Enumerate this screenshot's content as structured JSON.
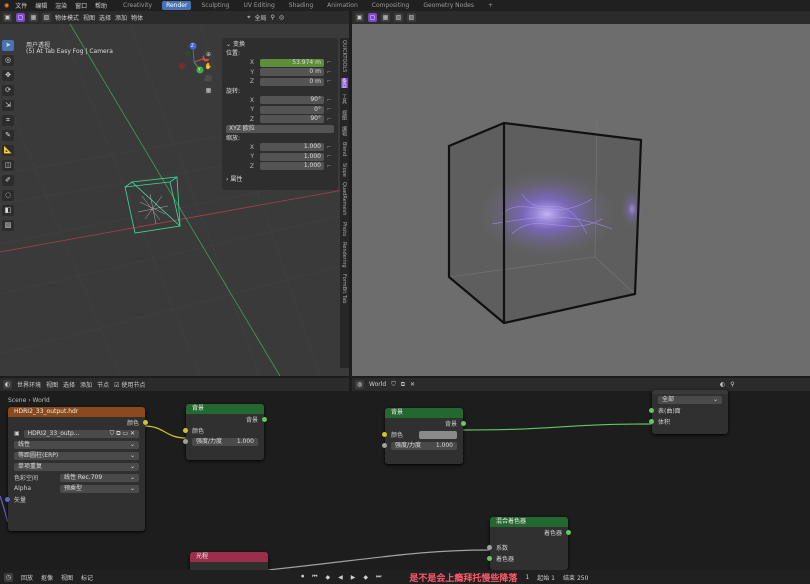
{
  "topbar": {
    "menus": [
      "文件",
      "编辑",
      "渲染",
      "窗口",
      "帮助"
    ],
    "workspace_tabs": [
      {
        "label": "Creativity",
        "active": false
      },
      {
        "label": "Render",
        "active": true
      },
      {
        "label": "Sculpting",
        "active": false
      },
      {
        "label": "UV Editing",
        "active": false
      },
      {
        "label": "Shading",
        "active": false
      },
      {
        "label": "Animation",
        "active": false
      },
      {
        "label": "Compositing",
        "active": false
      },
      {
        "label": "Geometry Nodes",
        "active": false
      }
    ],
    "add_tab": "+"
  },
  "viewport_header": {
    "mode": "物体模式",
    "menus": [
      "视图",
      "选择",
      "添加",
      "物体"
    ],
    "transform": "全局",
    "options": "选项"
  },
  "viewport": {
    "view_name": "用户透视",
    "object_info": "(5) At Tab Easy Fog | Camera",
    "axes": {
      "x": "X",
      "y": "Y",
      "z": "Z"
    }
  },
  "npanel": {
    "section_transform": "变换",
    "location_label": "位置:",
    "location": [
      {
        "axis": "X",
        "value": "53.974 m",
        "highlight": true
      },
      {
        "axis": "Y",
        "value": "0 m",
        "highlight": false
      },
      {
        "axis": "Z",
        "value": "0 m",
        "highlight": false
      }
    ],
    "rotation_label": "旋转:",
    "rotation": [
      {
        "axis": "X",
        "value": "90°"
      },
      {
        "axis": "Y",
        "value": "0°"
      },
      {
        "axis": "Z",
        "value": "90°"
      }
    ],
    "rotation_mode": "XYZ 欧拉",
    "scale_label": "缩放:",
    "scale": [
      {
        "axis": "X",
        "value": "1.000"
      },
      {
        "axis": "Y",
        "value": "1.000"
      },
      {
        "axis": "Z",
        "value": "1.000"
      }
    ],
    "section_props": "属性"
  },
  "side_tabs": [
    "QUICKTOOLS",
    "条目",
    "工具",
    "视图",
    "编辑",
    "Blend",
    "Slope",
    "QuadRemesh",
    "Photo",
    "Rendering",
    "FormBit Tab"
  ],
  "node_header": {
    "editor": "世界环境",
    "menus": [
      "视图",
      "选择",
      "添加",
      "节点"
    ],
    "use_nodes": "使用节点",
    "slot": "World"
  },
  "breadcrumb": {
    "scene": "Scene",
    "world": "World"
  },
  "nodes": {
    "env_tex": {
      "title": "HDRI2_33_output.hdr",
      "out_color": "颜色",
      "image_name": "HDRI2_33_outp...",
      "interp": "线性",
      "projection": "等距圆柱(ERP)",
      "extension": "单项重复",
      "colorspace_label": "色彩空间",
      "colorspace": "线性 Rec.709",
      "alpha_label": "Alpha",
      "alpha": "预乘型",
      "vector": "矢量"
    },
    "background1": {
      "title": "背景",
      "out": "背景",
      "in_color": "颜色",
      "strength_label": "强度/力度",
      "strength": "1.000"
    },
    "background2": {
      "title": "背景",
      "out": "背景",
      "in_color": "颜色",
      "strength_label": "强度/力度",
      "strength": "1.000"
    },
    "world_output": {
      "target": "全部",
      "in_surface": "表(曲)面",
      "in_volume": "体积"
    },
    "mix_shader": {
      "title": "混合着色器",
      "out": "着色器",
      "in_fac": "系数",
      "in_shader": "着色器"
    },
    "light_path": {
      "title": "光程"
    }
  },
  "status": {
    "left_items": [
      "回放",
      "抠像",
      "视图",
      "标记"
    ],
    "subtitle": "是不是会上瘾拜托慢些降落",
    "start_label": "起始",
    "start_value": "1",
    "end_label": "结束",
    "end_value": "250",
    "frame": "1"
  },
  "colors": {
    "accent": "#4772b3",
    "purple": "#7e47c9",
    "node_green": "#23692f",
    "node_orange": "#8a4a1e",
    "subtitle": "#ff5a6a"
  }
}
